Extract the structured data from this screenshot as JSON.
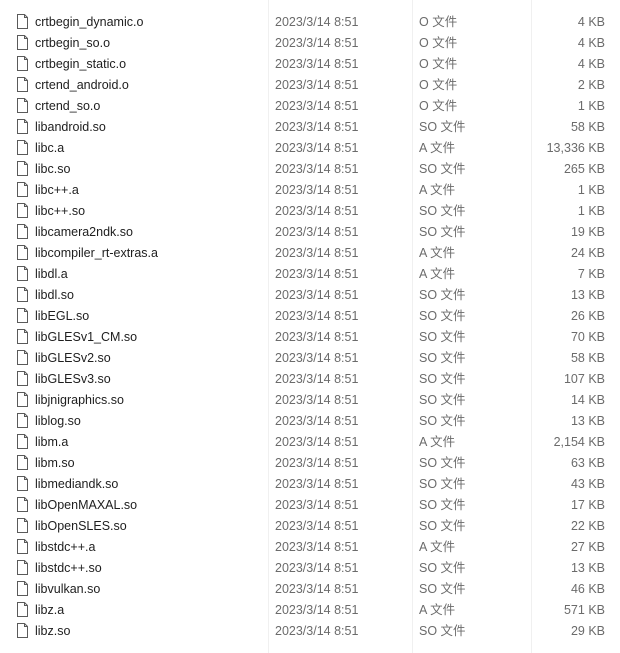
{
  "files": [
    {
      "name": "crtbegin_dynamic.o",
      "date": "2023/3/14 8:51",
      "type": "O 文件",
      "size": "4 KB"
    },
    {
      "name": "crtbegin_so.o",
      "date": "2023/3/14 8:51",
      "type": "O 文件",
      "size": "4 KB"
    },
    {
      "name": "crtbegin_static.o",
      "date": "2023/3/14 8:51",
      "type": "O 文件",
      "size": "4 KB"
    },
    {
      "name": "crtend_android.o",
      "date": "2023/3/14 8:51",
      "type": "O 文件",
      "size": "2 KB"
    },
    {
      "name": "crtend_so.o",
      "date": "2023/3/14 8:51",
      "type": "O 文件",
      "size": "1 KB"
    },
    {
      "name": "libandroid.so",
      "date": "2023/3/14 8:51",
      "type": "SO 文件",
      "size": "58 KB"
    },
    {
      "name": "libc.a",
      "date": "2023/3/14 8:51",
      "type": "A 文件",
      "size": "13,336 KB"
    },
    {
      "name": "libc.so",
      "date": "2023/3/14 8:51",
      "type": "SO 文件",
      "size": "265 KB"
    },
    {
      "name": "libc++.a",
      "date": "2023/3/14 8:51",
      "type": "A 文件",
      "size": "1 KB"
    },
    {
      "name": "libc++.so",
      "date": "2023/3/14 8:51",
      "type": "SO 文件",
      "size": "1 KB"
    },
    {
      "name": "libcamera2ndk.so",
      "date": "2023/3/14 8:51",
      "type": "SO 文件",
      "size": "19 KB"
    },
    {
      "name": "libcompiler_rt-extras.a",
      "date": "2023/3/14 8:51",
      "type": "A 文件",
      "size": "24 KB"
    },
    {
      "name": "libdl.a",
      "date": "2023/3/14 8:51",
      "type": "A 文件",
      "size": "7 KB"
    },
    {
      "name": "libdl.so",
      "date": "2023/3/14 8:51",
      "type": "SO 文件",
      "size": "13 KB"
    },
    {
      "name": "libEGL.so",
      "date": "2023/3/14 8:51",
      "type": "SO 文件",
      "size": "26 KB"
    },
    {
      "name": "libGLESv1_CM.so",
      "date": "2023/3/14 8:51",
      "type": "SO 文件",
      "size": "70 KB"
    },
    {
      "name": "libGLESv2.so",
      "date": "2023/3/14 8:51",
      "type": "SO 文件",
      "size": "58 KB"
    },
    {
      "name": "libGLESv3.so",
      "date": "2023/3/14 8:51",
      "type": "SO 文件",
      "size": "107 KB"
    },
    {
      "name": "libjnigraphics.so",
      "date": "2023/3/14 8:51",
      "type": "SO 文件",
      "size": "14 KB"
    },
    {
      "name": "liblog.so",
      "date": "2023/3/14 8:51",
      "type": "SO 文件",
      "size": "13 KB"
    },
    {
      "name": "libm.a",
      "date": "2023/3/14 8:51",
      "type": "A 文件",
      "size": "2,154 KB"
    },
    {
      "name": "libm.so",
      "date": "2023/3/14 8:51",
      "type": "SO 文件",
      "size": "63 KB"
    },
    {
      "name": "libmediandk.so",
      "date": "2023/3/14 8:51",
      "type": "SO 文件",
      "size": "43 KB"
    },
    {
      "name": "libOpenMAXAL.so",
      "date": "2023/3/14 8:51",
      "type": "SO 文件",
      "size": "17 KB"
    },
    {
      "name": "libOpenSLES.so",
      "date": "2023/3/14 8:51",
      "type": "SO 文件",
      "size": "22 KB"
    },
    {
      "name": "libstdc++.a",
      "date": "2023/3/14 8:51",
      "type": "A 文件",
      "size": "27 KB"
    },
    {
      "name": "libstdc++.so",
      "date": "2023/3/14 8:51",
      "type": "SO 文件",
      "size": "13 KB"
    },
    {
      "name": "libvulkan.so",
      "date": "2023/3/14 8:51",
      "type": "SO 文件",
      "size": "46 KB"
    },
    {
      "name": "libz.a",
      "date": "2023/3/14 8:51",
      "type": "A 文件",
      "size": "571 KB"
    },
    {
      "name": "libz.so",
      "date": "2023/3/14 8:51",
      "type": "SO 文件",
      "size": "29 KB"
    }
  ]
}
